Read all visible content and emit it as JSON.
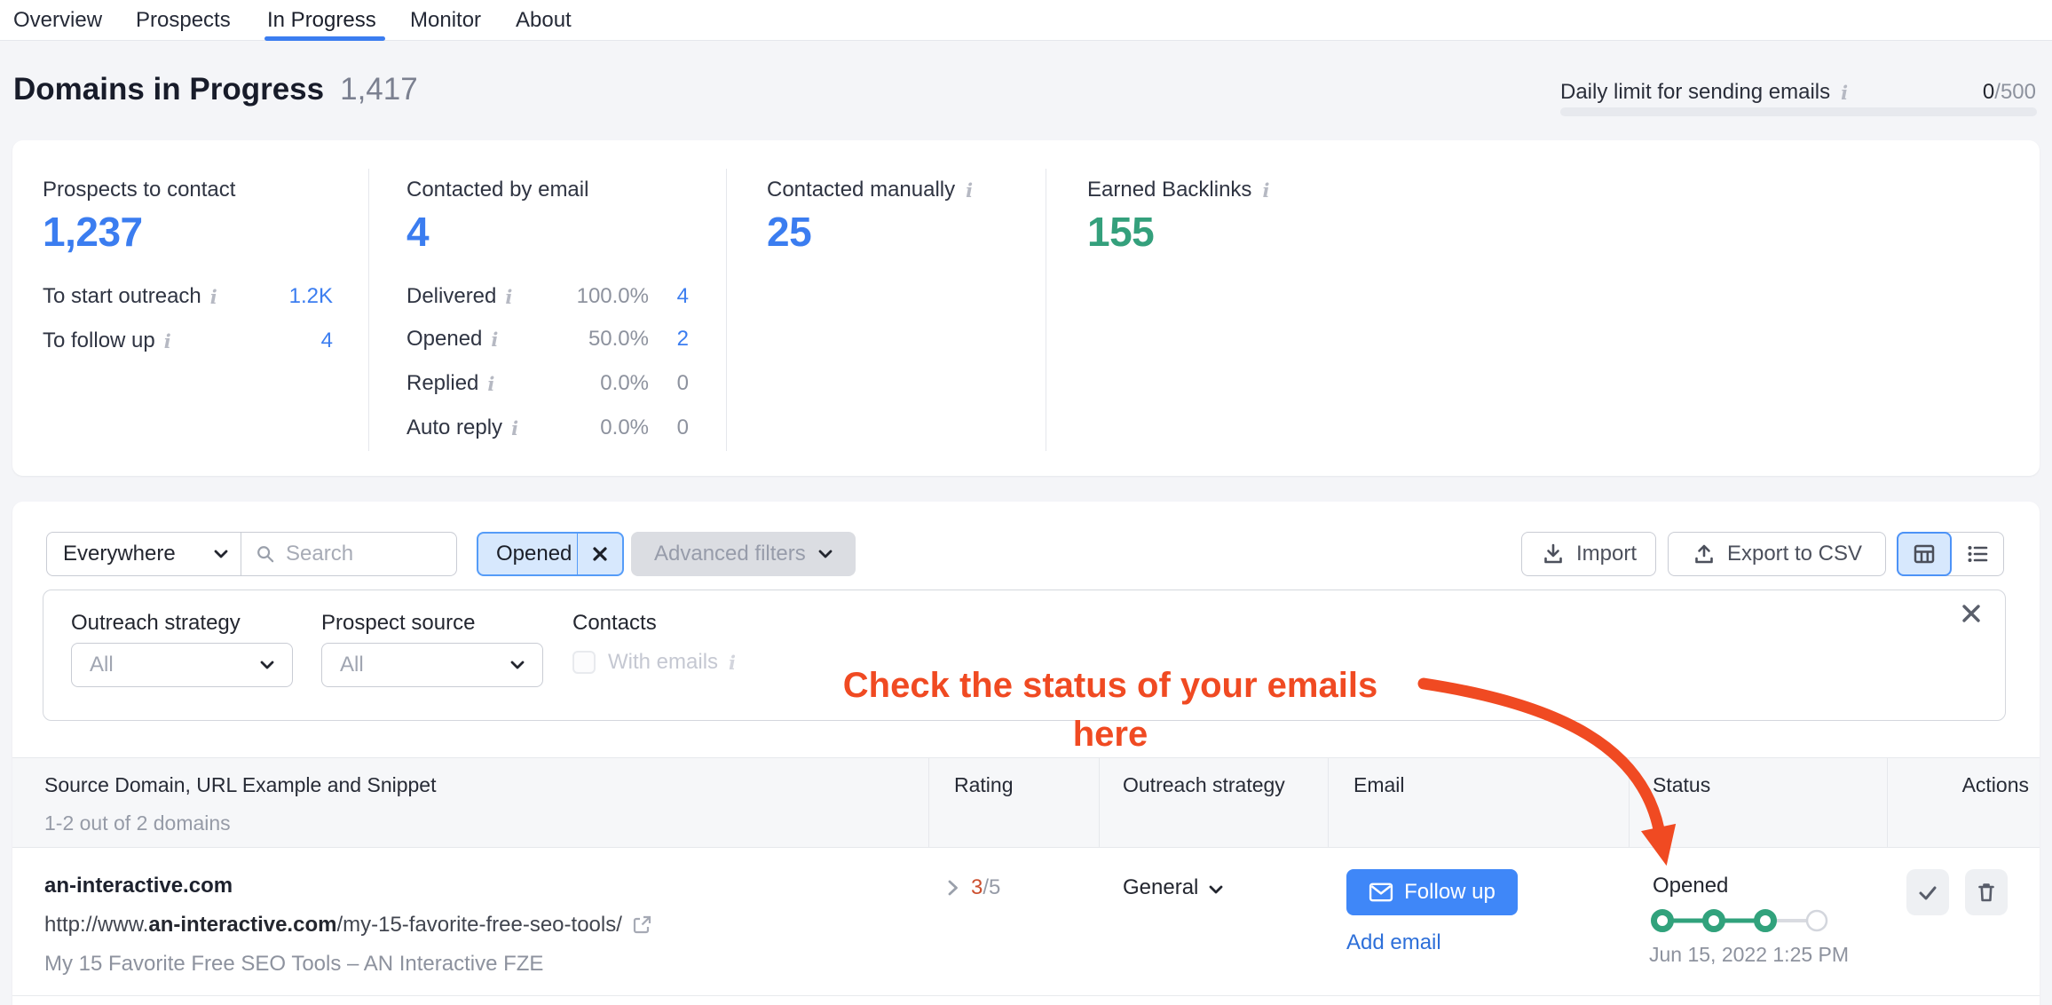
{
  "icons": {
    "info": "i"
  },
  "nav": {
    "tabs": [
      {
        "label": "Overview"
      },
      {
        "label": "Prospects"
      },
      {
        "label": "In Progress"
      },
      {
        "label": "Monitor"
      },
      {
        "label": "About"
      }
    ]
  },
  "header": {
    "title": "Domains in Progress",
    "count": "1,417"
  },
  "daily_limit": {
    "label": "Daily limit for sending emails",
    "used": "0",
    "total": "/500"
  },
  "stats": {
    "prospects": {
      "label": "Prospects to contact",
      "value": "1,237",
      "rows": [
        {
          "label": "To start outreach",
          "value": "1.2K"
        },
        {
          "label": "To follow up",
          "value": "4"
        }
      ]
    },
    "contacted_by_email": {
      "label": "Contacted by email",
      "value": "4",
      "rows": [
        {
          "label": "Delivered",
          "pct": "100.0%",
          "value": "4"
        },
        {
          "label": "Opened",
          "pct": "50.0%",
          "value": "2"
        },
        {
          "label": "Replied",
          "pct": "0.0%",
          "value": "0"
        },
        {
          "label": "Auto reply",
          "pct": "0.0%",
          "value": "0"
        }
      ]
    },
    "contacted_manually": {
      "label": "Contacted manually",
      "value": "25"
    },
    "earned_backlinks": {
      "label": "Earned Backlinks",
      "value": "155"
    }
  },
  "toolbar": {
    "scope": "Everywhere",
    "search_placeholder": "Search",
    "chip_label": "Opened",
    "advanced_label": "Advanced filters",
    "import_label": "Import",
    "export_label": "Export to CSV"
  },
  "filters": {
    "outreach_strategy_label": "Outreach strategy",
    "outreach_strategy_value": "All",
    "prospect_source_label": "Prospect source",
    "prospect_source_value": "All",
    "contacts_label": "Contacts",
    "with_emails_label": "With emails"
  },
  "annotation": {
    "line1": "Check the status of your emails",
    "line2": "here"
  },
  "table": {
    "header": {
      "source": "Source Domain, URL Example and Snippet",
      "range": "1-2 out of 2 domains",
      "rating": "Rating",
      "outreach": "Outreach strategy",
      "email": "Email",
      "status": "Status",
      "actions": "Actions"
    },
    "row": {
      "domain": "an-interactive.com",
      "url_prefix": "http://www.",
      "url_domain": "an-interactive.com",
      "url_path": "/my-15-favorite-free-seo-tools/",
      "snippet": "My 15 Favorite Free SEO Tools – AN Interactive FZE",
      "rating_value": "3",
      "rating_total": "/5",
      "strategy": "General",
      "email_button": "Follow up",
      "add_email": "Add email",
      "status": "Opened",
      "status_date": "Jun 15, 2022 1:25 PM"
    }
  },
  "colors": {
    "accent_blue": "#3f87f8",
    "value_blue": "#3b7df0",
    "green": "#34a07c",
    "red": "#f04a22",
    "rating_orange": "#cc4f2e"
  }
}
